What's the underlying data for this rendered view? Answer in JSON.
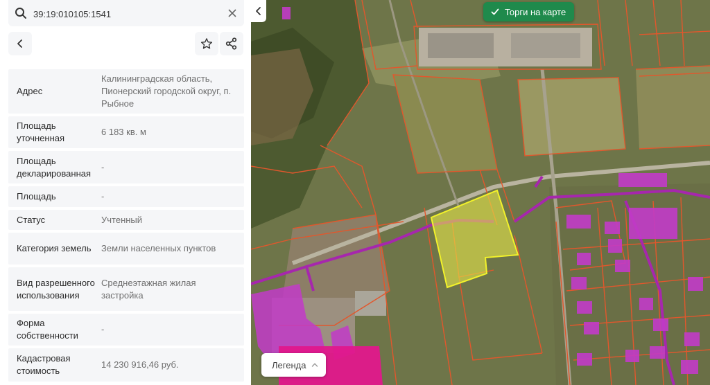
{
  "search": {
    "value": "39:19:010105:1541"
  },
  "properties": [
    {
      "label": "Адрес",
      "value": "Калининградская область, Пионерский городской округ, п. Рыбное"
    },
    {
      "label": "Площадь уточненная",
      "value": "6 183 кв. м"
    },
    {
      "label": "Площадь декларированная",
      "value": "-"
    },
    {
      "label": "Площадь",
      "value": "-"
    },
    {
      "label": "Статус",
      "value": "Учтенный"
    },
    {
      "label": "Категория земель",
      "value": "Земли населенных пунктов"
    },
    {
      "label": "Вид разрешенного использования",
      "value": "Среднеэтажная жилая застройка"
    },
    {
      "label": "Форма собственности",
      "value": "-"
    },
    {
      "label": "Кадастровая стоимость",
      "value": "14 230 916,46 руб."
    }
  ],
  "map": {
    "auction_label": "Торги на карте",
    "legend_label": "Легенда",
    "colors": {
      "parcel_border": "#e2572c",
      "selected_fill": "#e6e64a",
      "selected_border": "#f2f22a",
      "zone_magenta": "#c23bc8",
      "zone_pink": "#e0188c",
      "accent_green": "#1f8a4c"
    }
  },
  "icons": {
    "search": "search-icon",
    "clear": "close-icon",
    "back": "chevron-left-icon",
    "favorite": "star-icon",
    "share": "share-icon",
    "collapse": "chevron-left-icon",
    "auction": "check-icon",
    "legend": "chevron-up-icon"
  }
}
